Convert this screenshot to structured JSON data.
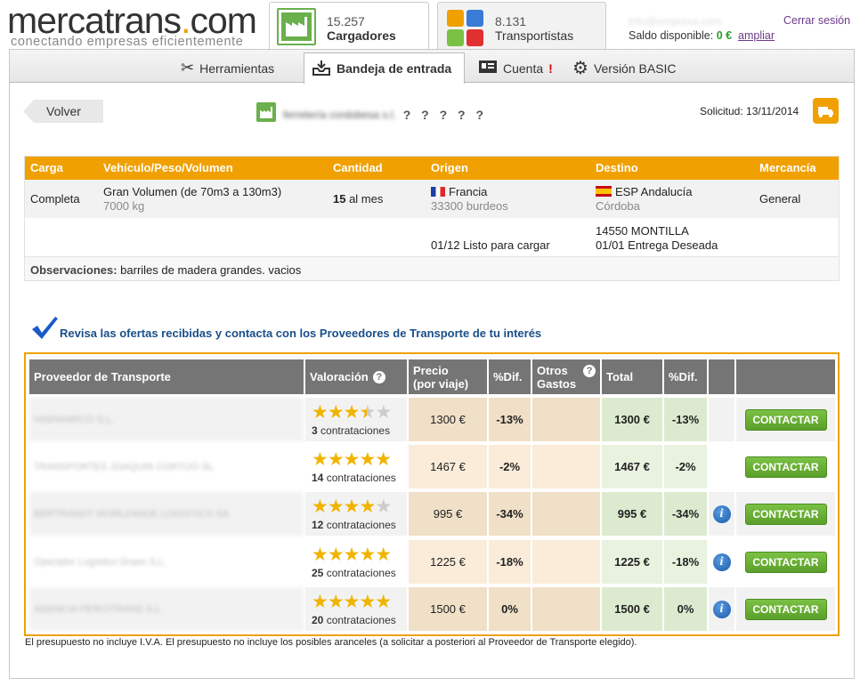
{
  "brand": {
    "logo_word": "mercatrans",
    "logo_dot": ".",
    "logo_suffix": "com",
    "tagline": "conectando empresas eficientemente"
  },
  "top_tabs": [
    {
      "count": "15.257",
      "label": "Cargadores"
    },
    {
      "count": "8.131",
      "label": "Transportistas"
    }
  ],
  "account": {
    "email": "info@empresa.com",
    "logout": "Cerrar sesión",
    "balance_label": "Saldo disponible:",
    "balance": "0 €",
    "expand": "ampliar"
  },
  "subnav": [
    {
      "label": "Herramientas",
      "icon": "tools-icon"
    },
    {
      "label": "Bandeja de entrada",
      "icon": "inbox-icon"
    },
    {
      "label": "Cuenta",
      "icon": "id-card-icon",
      "alert": "!"
    },
    {
      "label": "Versión BASIC",
      "icon": "gear-icon"
    }
  ],
  "back": "Volver",
  "company": {
    "name": "ferretería cordobesa s.l.",
    "rating": "? ? ? ? ?"
  },
  "request_date": "Solicitud: 13/11/2014",
  "load": {
    "headers": [
      "Carga",
      "Vehículo/Peso/Volumen",
      "Cantidad",
      "Origen",
      "Destino",
      "Mercancía"
    ],
    "carga": "Completa",
    "vehiculo": "Gran Volumen (de 70m3 a 130m3)",
    "peso": "7000 kg",
    "cantidad_num": "15",
    "cantidad_unit": " al mes",
    "origen_pais": "Francia",
    "origen_detalle": "33300 burdeos",
    "origen_fecha": "01/12 Listo para cargar",
    "destino_pais": "ESP Andalucía",
    "destino_detalle": "Córdoba",
    "destino_cp": "14550 MONTILLA",
    "destino_fecha": "01/01 Entrega Deseada",
    "mercancia": "General",
    "obs_label": "Observaciones:",
    "obs_text": " barriles de madera grandes. vacios"
  },
  "offers_title": "Revisa las ofertas recibidas y contacta con los Proveedores de Transporte de tu interés",
  "offers_headers": {
    "proveedor": "Proveedor de Transporte",
    "valoracion": "Valoración",
    "precio_1": "Precio",
    "precio_2": "(por viaje)",
    "dif": "%Dif.",
    "otros_1": "Otros",
    "otros_2": "Gastos",
    "total": "Total",
    "dif2": "%Dif."
  },
  "offers": [
    {
      "provider": "HISPANIRCO S.L.",
      "stars": 3.5,
      "count": "3",
      "count_label": " contrataciones",
      "price": "1300 €",
      "dif": "-13%",
      "total": "1300 €",
      "dif2": "-13%",
      "info": false,
      "button": "CONTACTAR"
    },
    {
      "provider": "TRANSPORTES JOAQUIN CORTIJO SL",
      "stars": 5,
      "count": "14",
      "count_label": " contrataciones",
      "price": "1467 €",
      "dif": "-2%",
      "total": "1467 €",
      "dif2": "-2%",
      "info": false,
      "button": "CONTACTAR"
    },
    {
      "provider": "BERTRANDT WORLDWIDE LOGISTICS SA",
      "stars": 4,
      "count": "12",
      "count_label": " contrataciones",
      "price": "995 €",
      "dif": "-34%",
      "total": "995 €",
      "dif2": "-34%",
      "info": true,
      "button": "CONTACTAR"
    },
    {
      "provider": "Operador Logístico Draeo S.L.",
      "stars": 5,
      "count": "25",
      "count_label": " contrataciones",
      "price": "1225 €",
      "dif": "-18%",
      "total": "1225 €",
      "dif2": "-18%",
      "info": true,
      "button": "CONTACTAR"
    },
    {
      "provider": "AGENCIA PERCITRANS S.L.",
      "stars": 5,
      "count": "20",
      "count_label": " contrataciones",
      "price": "1500 €",
      "dif": "0%",
      "total": "1500 €",
      "dif2": "0%",
      "info": true,
      "button": "CONTACTAR"
    }
  ],
  "footnote": "El presupuesto no incluye I.V.A. El presupuesto no incluye los posibles aranceles (a solicitar a posteriori al Proveedor de Transporte elegido).",
  "colors": {
    "accent": "#f0a000",
    "green": "#6ab04c",
    "header_gray": "#757575",
    "link_blue": "#1a4f8a"
  }
}
